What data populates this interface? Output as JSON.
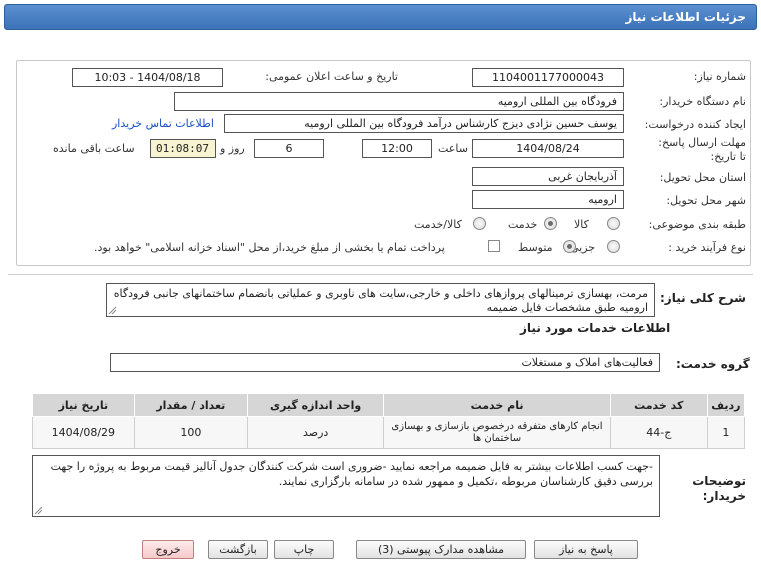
{
  "window": {
    "title": "جزئیات اطلاعات نیاز"
  },
  "form": {
    "need_number_label": "شماره نیاز:",
    "need_number_value": "1104001177000043",
    "announce_label": "تاریخ و ساعت اعلان عمومی:",
    "announce_value": "1404/08/18 - 10:03",
    "buyer_org_label": "نام دستگاه خریدار:",
    "buyer_org_value": "فرودگاه بین المللی ارومیه",
    "creator_label": "ایجاد کننده درخواست:",
    "creator_value": "یوسف حسین نژادی دیزج کارشناس درآمد فرودگاه بین المللی ارومیه",
    "contact_link": "اطلاعات تماس خریدار",
    "deadline_label": "مهلت ارسال پاسخ: تا تاریخ:",
    "deadline_date": "1404/08/24",
    "time_label": "ساعت",
    "deadline_time": "12:00",
    "days_value": "6",
    "days_label": "روز و",
    "remaining_timer": "01:08:07",
    "remaining_label": "ساعت باقی مانده",
    "province_label": "استان محل تحویل:",
    "province_value": "آذربایجان غربی",
    "city_label": "شهر محل تحویل:",
    "city_value": "ارومیه",
    "category_label": "طبقه بندی موضوعی:",
    "category_options": [
      "کالا",
      "خدمت",
      "کالا/خدمت"
    ],
    "category_selected": "خدمت",
    "process_label": "نوع فرآیند خرید :",
    "process_options": [
      "جزیی",
      "متوسط"
    ],
    "process_selected": "متوسط",
    "payment_note": "پرداخت تمام یا بخشی از مبلغ خرید،از محل \"اسناد خزانه اسلامی\" خواهد بود."
  },
  "summary": {
    "label": "شرح کلی نیاز:",
    "text": "مرمت، بهسازی ترمینالهای پروازهای داخلی و خارجی،سایت های ناوبری و عملیاتی بانضمام ساختمانهای جانبی فرودگاه ارومیه طبق مشخصات فایل ضمیمه"
  },
  "services": {
    "section_title": "اطلاعات خدمات مورد نیاز",
    "group_label": "گروه خدمت:",
    "group_value": "فعالیت‌های  املاک و مستغلات",
    "columns": [
      "ردیف",
      "کد خدمت",
      "نام خدمت",
      "واحد اندازه گیری",
      "تعداد / مقدار",
      "تاریخ نیاز"
    ],
    "rows": [
      {
        "row": "1",
        "code": "ج-44",
        "name": "انجام کارهای متفرقه درخصوص بازسازی و بهسازی ساختمان ها",
        "unit": "درصد",
        "qty": "100",
        "date": "1404/08/29"
      }
    ]
  },
  "buyer_notes": {
    "label": "توضیحات خریدار:",
    "text": "-جهت کسب اطلاعات بیشتر به فایل ضمیمه مراجعه نمایید -ضروری است شرکت کنندگان جدول آنالیز قیمت مربوط به پروژه را جهت بررسی دقیق کارشناسان مربوطه ،تکمیل و ممهور شده در سامانه بارگزاری نمایند."
  },
  "buttons": {
    "reply": "پاسخ به نیاز",
    "attachments": "مشاهده مدارک پیوستی (3)",
    "print": "چاپ",
    "back": "بازگشت",
    "exit": "خروج"
  },
  "colors": {
    "titlebar": "#3c72b8",
    "link": "#1a4fc4",
    "timer_bg": "#f8f3d0",
    "exit_bg": "#f5c9c9"
  }
}
